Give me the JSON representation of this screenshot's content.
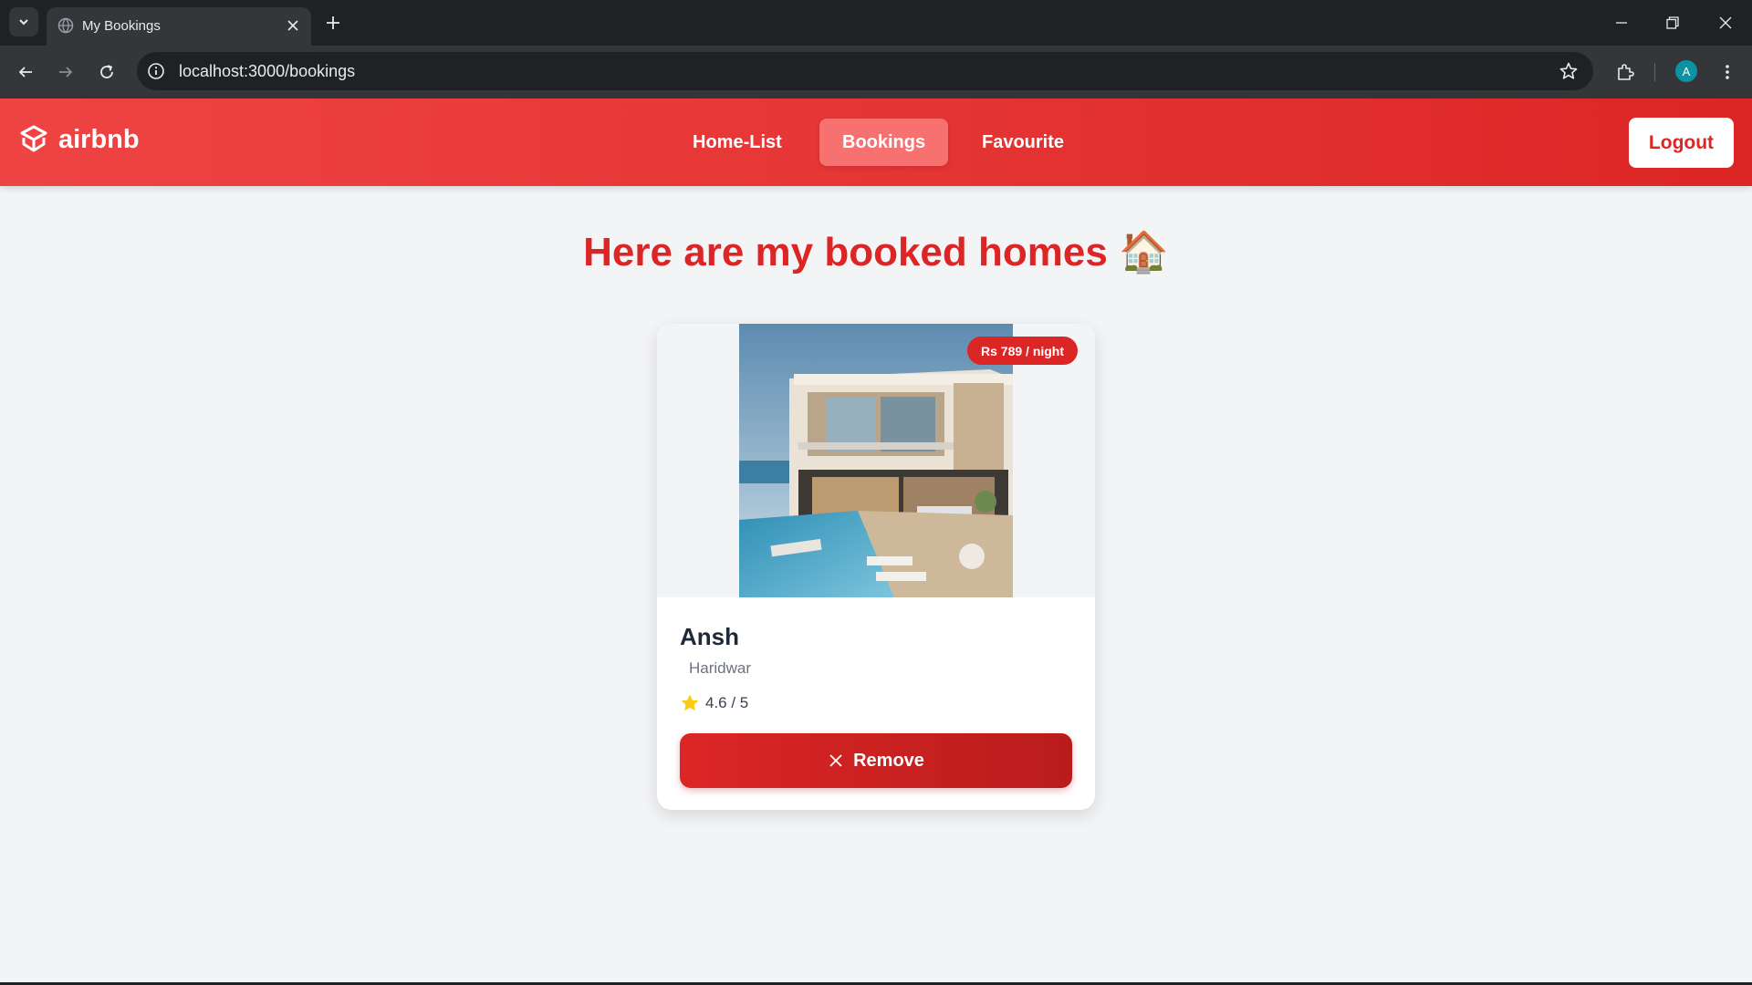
{
  "browser": {
    "tab_title": "My Bookings",
    "url": "localhost:3000/bookings",
    "profile_initial": "A"
  },
  "header": {
    "logo_text": "airbnb",
    "nav": [
      {
        "label": "Home-List",
        "active": false
      },
      {
        "label": "Bookings",
        "active": true
      },
      {
        "label": "Favourite",
        "active": false
      }
    ],
    "logout_label": "Logout"
  },
  "main": {
    "title": "Here are my booked homes 🏠",
    "bookings": [
      {
        "name": "Ansh",
        "location": "Haridwar",
        "price_badge": "Rs 789 / night",
        "rating": "4.6 / 5",
        "remove_label": "Remove"
      }
    ]
  },
  "colors": {
    "brand": "#dc2626",
    "header_start": "#ef4444",
    "nav_active": "#f87171",
    "page_bg": "#f3f4f6",
    "star": "#facc15"
  },
  "icons": [
    "tab-search-icon",
    "globe-icon",
    "close-icon",
    "plus-icon",
    "minimize-icon",
    "restore-icon",
    "back-arrow-icon",
    "forward-arrow-icon",
    "reload-icon",
    "info-icon",
    "bookmark-star-icon",
    "extensions-icon",
    "kebab-menu-icon",
    "logo-icon",
    "star-icon",
    "remove-x-icon"
  ]
}
